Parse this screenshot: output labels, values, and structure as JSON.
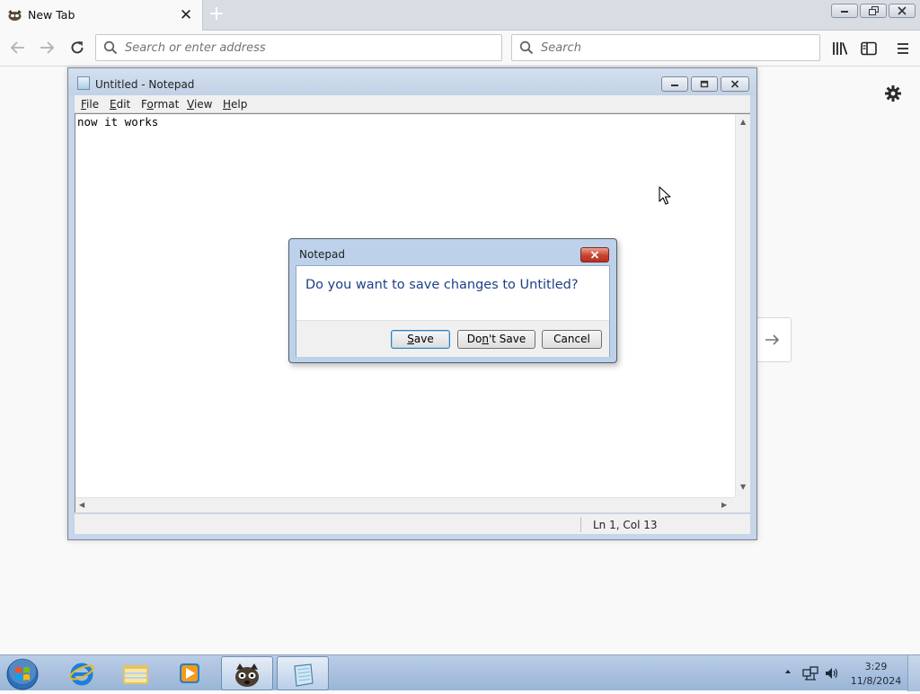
{
  "browser": {
    "tab_title": "New Tab",
    "tab_close": "✕",
    "new_tab": "+",
    "url_placeholder": "Search or enter address",
    "search_placeholder": "Search",
    "icons": [
      "firefox-tab-icon",
      "back-icon",
      "forward-icon",
      "reload-icon",
      "search-icon",
      "library-icon",
      "sidebar-icon",
      "hamburger-menu-icon",
      "gear-icon",
      "arrow-right-icon"
    ]
  },
  "notepad": {
    "title": "Untitled - Notepad",
    "menu": {
      "file": {
        "mnemonic": "F",
        "rest": "ile"
      },
      "edit": {
        "mnemonic": "E",
        "rest": "dit"
      },
      "format": {
        "mnemonic": "o",
        "pre": "F",
        "rest": "rmat"
      },
      "view": {
        "mnemonic": "V",
        "rest": "iew"
      },
      "help": {
        "mnemonic": "H",
        "rest": "elp"
      }
    },
    "content": "now it works",
    "status_position": "Ln 1, Col 13"
  },
  "dialog": {
    "title": "Notepad",
    "message": "Do you want to save changes to Untitled?",
    "save": {
      "mnemonic": "S",
      "rest": "ave"
    },
    "dont_save": {
      "pre": "Do",
      "mnemonic": "n",
      "rest": "'t Save"
    },
    "cancel": "Cancel"
  },
  "taskbar": {
    "items": [
      "internet-explorer",
      "windows-explorer",
      "media-player",
      "firefox",
      "notepad"
    ],
    "active": [
      "firefox",
      "notepad"
    ],
    "clock_time": "3:29",
    "clock_date": "11/8/2024"
  },
  "colors": {
    "dialog_message": "#1e3f86",
    "taskbar": "#a9c0dd",
    "titlebar": "#c6d5e8"
  }
}
